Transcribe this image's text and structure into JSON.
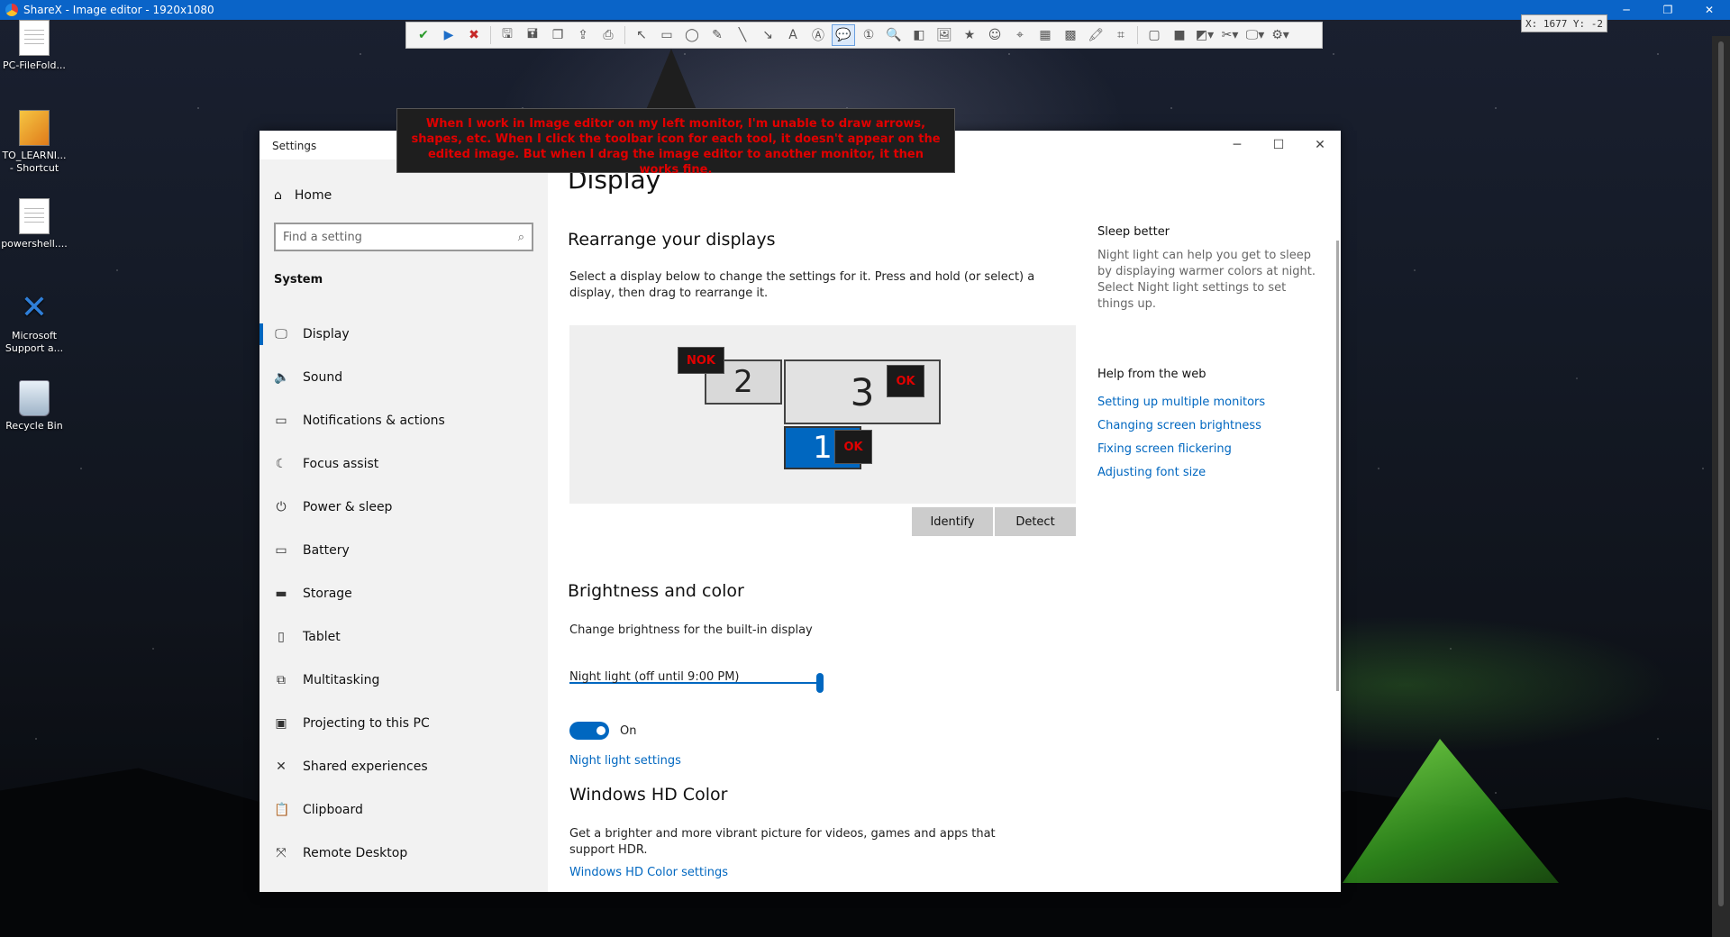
{
  "titlebar": {
    "title": "ShareX - Image editor - 1920x1080"
  },
  "coords": "X: 1677 Y: -2",
  "desktop": {
    "icons": [
      {
        "label": "PC-FileFold..."
      },
      {
        "label": "TO_LEARNI... - Shortcut"
      },
      {
        "label": "powershell...."
      },
      {
        "label": "Microsoft Support a..."
      },
      {
        "label": "Recycle Bin"
      }
    ]
  },
  "callout": {
    "text": "When I work in Image editor on my left monitor, I'm unable to draw arrows, shapes, etc.  When I click the toolbar icon for each tool, it doesn't appear on the edited image. But when I drag the image editor to another monitor, it then works fine."
  },
  "toolbar": {
    "icons": [
      "check-icon",
      "run-icon",
      "close-icon",
      "save-icon",
      "save-as-icon",
      "copy-icon",
      "upload-icon",
      "print-icon",
      "select-icon",
      "rectangle-icon",
      "ellipse-icon",
      "freehand-icon",
      "line-icon",
      "arrow-icon",
      "text-outline-icon",
      "text-background-icon",
      "speech-balloon-icon",
      "step-icon",
      "magnify-icon",
      "smart-eraser-icon",
      "image-icon",
      "sticker-icon",
      "emoji-icon",
      "cursor-icon",
      "blur-icon",
      "pixelate-icon",
      "highlight-icon",
      "crop-icon",
      "border-color-icon",
      "fill-color-icon",
      "shadow-icon",
      "tools-icon",
      "image-settings-icon",
      "settings-icon"
    ]
  },
  "settings": {
    "window_title": "Settings",
    "home": "Home",
    "search_placeholder": "Find a setting",
    "section": "System",
    "nav": [
      {
        "label": "Display",
        "icon": "monitor-icon",
        "glyph": "🖵"
      },
      {
        "label": "Sound",
        "icon": "speaker-icon",
        "glyph": "🔈"
      },
      {
        "label": "Notifications & actions",
        "icon": "notification-icon",
        "glyph": "▭"
      },
      {
        "label": "Focus assist",
        "icon": "moon-icon",
        "glyph": "☾"
      },
      {
        "label": "Power & sleep",
        "icon": "power-icon",
        "glyph": "⏻"
      },
      {
        "label": "Battery",
        "icon": "battery-icon",
        "glyph": "▭"
      },
      {
        "label": "Storage",
        "icon": "storage-icon",
        "glyph": "▬"
      },
      {
        "label": "Tablet",
        "icon": "tablet-icon",
        "glyph": "▯"
      },
      {
        "label": "Multitasking",
        "icon": "multitasking-icon",
        "glyph": "⧉"
      },
      {
        "label": "Projecting to this PC",
        "icon": "projecting-icon",
        "glyph": "▣"
      },
      {
        "label": "Shared experiences",
        "icon": "shared-icon",
        "glyph": "✕"
      },
      {
        "label": "Clipboard",
        "icon": "clipboard-icon",
        "glyph": "📋"
      },
      {
        "label": "Remote Desktop",
        "icon": "remote-desktop-icon",
        "glyph": "⤧"
      }
    ],
    "page_title": "Display",
    "rearrange": {
      "heading": "Rearrange your displays",
      "description": "Select a display below to change the settings for it. Press and hold (or select) a display, then drag to rearrange it.",
      "monitors": [
        {
          "number": "2"
        },
        {
          "number": "3"
        },
        {
          "number": "1"
        }
      ],
      "badges": {
        "nok": "NOK",
        "ok3": "OK",
        "ok1": "OK"
      },
      "identify": "Identify",
      "detect": "Detect"
    },
    "brightness": {
      "heading": "Brightness and color",
      "label": "Change brightness for the built-in display",
      "value": 1.0,
      "night_light_label": "Night light (off until 9:00 PM)",
      "toggle_state": "On",
      "night_light_link": "Night light settings"
    },
    "hdr": {
      "heading": "Windows HD Color",
      "description": "Get a brighter and more vibrant picture for videos, games and apps that support HDR.",
      "link": "Windows HD Color settings"
    },
    "aside": {
      "sleep_heading": "Sleep better",
      "sleep_text": "Night light can help you get to sleep by displaying warmer colors at night. Select Night light settings to set things up.",
      "help_heading": "Help from the web",
      "links": [
        "Setting up multiple monitors",
        "Changing screen brightness",
        "Fixing screen flickering",
        "Adjusting font size"
      ]
    }
  }
}
